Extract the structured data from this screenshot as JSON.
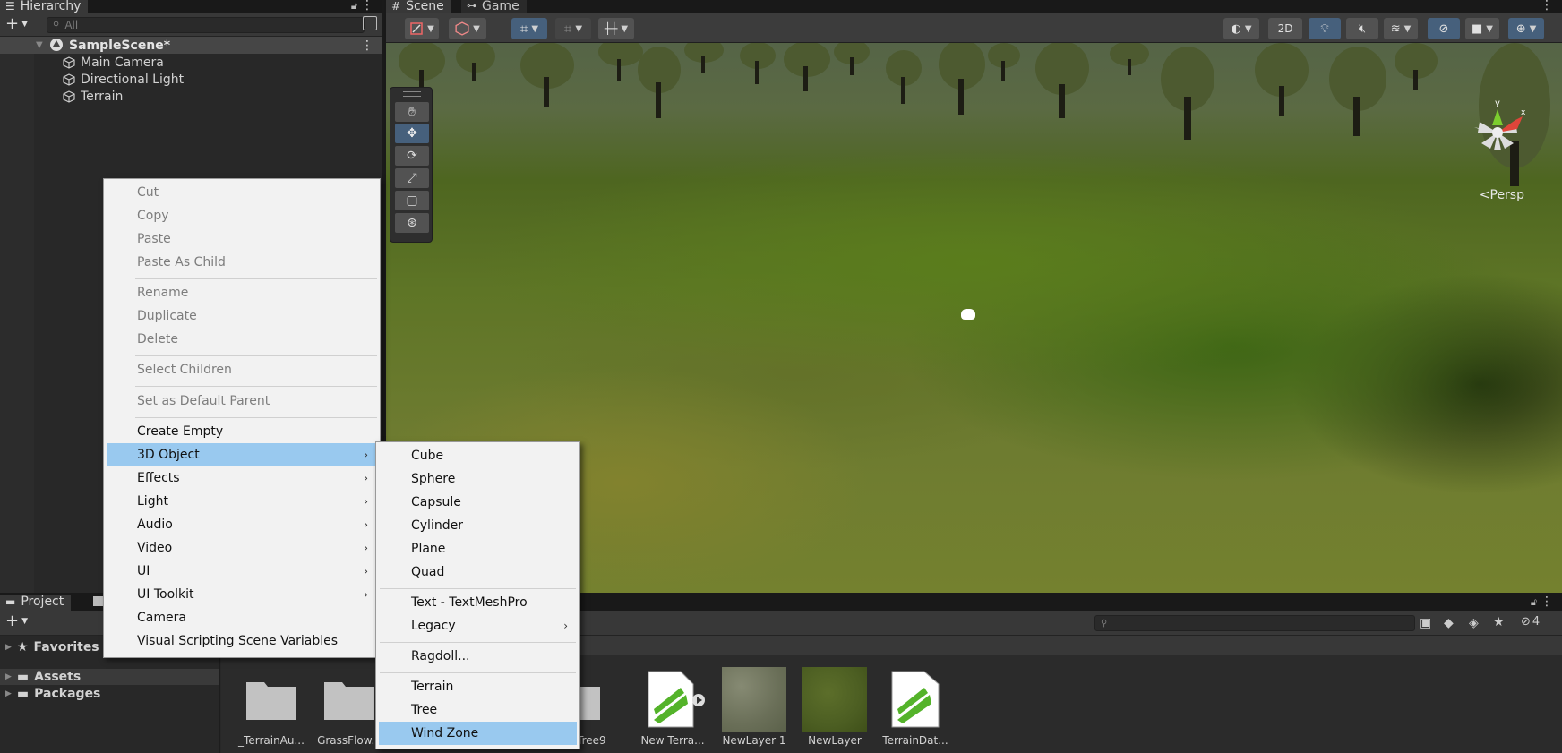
{
  "hierarchy": {
    "tab": "Hierarchy",
    "search_placeholder": "All",
    "scene": "SampleScene*",
    "items": [
      "Main Camera",
      "Directional Light",
      "Terrain"
    ]
  },
  "scene_view": {
    "tabs": [
      "Scene",
      "Game"
    ],
    "toolbar": {
      "mode_2d": "2D"
    },
    "persp_label": "<Persp",
    "gizmo_axes": {
      "y": "y",
      "x": "x"
    }
  },
  "project": {
    "tab": "Project",
    "favorites": "Favorites",
    "assets": "Assets",
    "packages": "Packages",
    "hidden_count": "4",
    "items": [
      "_TerrainAu...",
      "GrassFlow...",
      "Tree9",
      "New Terra...",
      "NewLayer 1",
      "NewLayer",
      "TerrainDat..."
    ]
  },
  "context_menu": {
    "items": {
      "cut": "Cut",
      "copy": "Copy",
      "paste": "Paste",
      "paste_child": "Paste As Child",
      "rename": "Rename",
      "duplicate": "Duplicate",
      "delete": "Delete",
      "select_children": "Select Children",
      "set_default_parent": "Set as Default Parent",
      "create_empty": "Create Empty",
      "object_3d": "3D Object",
      "effects": "Effects",
      "light": "Light",
      "audio": "Audio",
      "video": "Video",
      "ui": "UI",
      "ui_toolkit": "UI Toolkit",
      "camera": "Camera",
      "visual_scripting": "Visual Scripting Scene Variables"
    }
  },
  "submenu": {
    "items": {
      "cube": "Cube",
      "sphere": "Sphere",
      "capsule": "Capsule",
      "cylinder": "Cylinder",
      "plane": "Plane",
      "quad": "Quad",
      "text_tmp": "Text - TextMeshPro",
      "legacy": "Legacy",
      "ragdoll": "Ragdoll...",
      "terrain": "Terrain",
      "tree": "Tree",
      "wind_zone": "Wind Zone"
    }
  },
  "colors": {
    "menu_highlight": "#99c9ef",
    "active_tool": "#46607c",
    "panel": "#282828"
  }
}
